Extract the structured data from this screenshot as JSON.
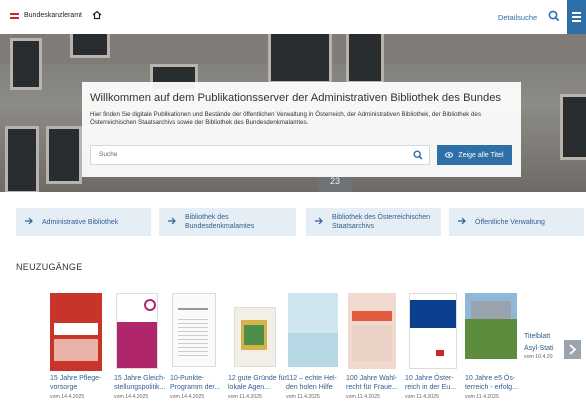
{
  "header": {
    "logo_text": "Bundeskanzleramt",
    "detail_search_label": "Detailsuche"
  },
  "hero": {
    "title": "Willkommen auf dem Publikationsserver der Administrativen Bibliothek des Bundes",
    "description": "Hier finden Sie digitale Publikationen und Bestände der öffentlichen Verwaltung in Österreich, der Administrativen Bibliothek, der Bibliothek des Österreichischen Staatsarchivs sowie der Bibliothek des Bundesdenkmalamtes.",
    "search_placeholder": "Suche",
    "show_all_label": "Zeige alle Titel",
    "building_number": "23"
  },
  "tiles": [
    {
      "label": "Administrative Bibliothek"
    },
    {
      "label": "Bibliothek des Bundesdenkmalamtes"
    },
    {
      "label": "Bibliothek des Österreichischen Staatsarchivs"
    },
    {
      "label": "Öffentliche Verwaltung"
    }
  ],
  "section_title": "NEUZUGÄNGE",
  "books": [
    {
      "title": "15 Jahre Pflege-vorsorge",
      "date": "vom 14.4.2025"
    },
    {
      "title": "15 Jahre Gleich-stellungspolitik...",
      "date": "vom 14.4.2025"
    },
    {
      "title": "10-Punkte-Programm der...",
      "date": "vom 14.4.2025"
    },
    {
      "title": "12 gute Gründe für lokale Agen...",
      "date": "vom 11.4.2025"
    },
    {
      "title": "112 – echte Hel-den holen Hilfe",
      "date": "vom 11.4.2025"
    },
    {
      "title": "100 Jahre Wahl-recht für Fraue...",
      "date": "vom 11.4.2025"
    },
    {
      "title": "10 Jahre Öster-reich in der Eu...",
      "date": "vom 11.4.2025"
    },
    {
      "title": "10 Jahre e5 Ös-terreich - erfolg...",
      "date": "vom 11.4.2025"
    },
    {
      "title": "Titelblatt Asyl-Stati",
      "date": "vom 10.4.20"
    }
  ],
  "colors": {
    "accent": "#2f6fa8",
    "tile_bg": "#e6eef5",
    "flag_red": "#d8232a"
  }
}
